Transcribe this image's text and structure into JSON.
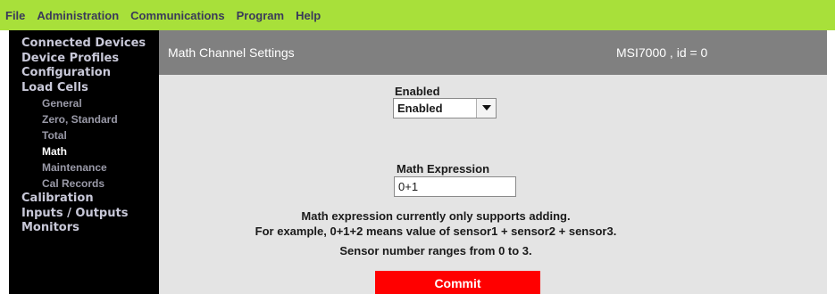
{
  "menubar": {
    "items": [
      "File",
      "Administration",
      "Communications",
      "Program",
      "Help"
    ]
  },
  "sidebar": {
    "items": [
      {
        "label": "Connected Devices"
      },
      {
        "label": "Device Profiles"
      },
      {
        "label": "Configuration"
      },
      {
        "label": "Load Cells"
      },
      {
        "label": "General"
      },
      {
        "label": "Zero, Standard"
      },
      {
        "label": "Total"
      },
      {
        "label": "Math"
      },
      {
        "label": "Maintenance"
      },
      {
        "label": "Cal Records"
      },
      {
        "label": "Calibration"
      },
      {
        "label": "Inputs / Outputs"
      },
      {
        "label": "Monitors"
      }
    ]
  },
  "header": {
    "title": "Math Channel Settings",
    "device": "MSI7000 , id = 0"
  },
  "form": {
    "enabled_label": "Enabled",
    "enabled_value": "Enabled",
    "expression_label": "Math Expression",
    "expression_value": "0+1",
    "note_line1": "Math expression currently only supports adding.",
    "note_line2": "For example, 0+1+2 means value of sensor1 + sensor2 + sensor3.",
    "note_line3": "Sensor number ranges from 0 to 3.",
    "commit_label": "Commit"
  },
  "colors": {
    "menubar_bg": "#a8e03a",
    "sidebar_bg": "#000000",
    "header_bg": "#808080",
    "content_bg": "#e4e4e4",
    "commit_bg": "#ff0000"
  },
  "icons": {
    "dropdown": "triangle-down-icon"
  }
}
